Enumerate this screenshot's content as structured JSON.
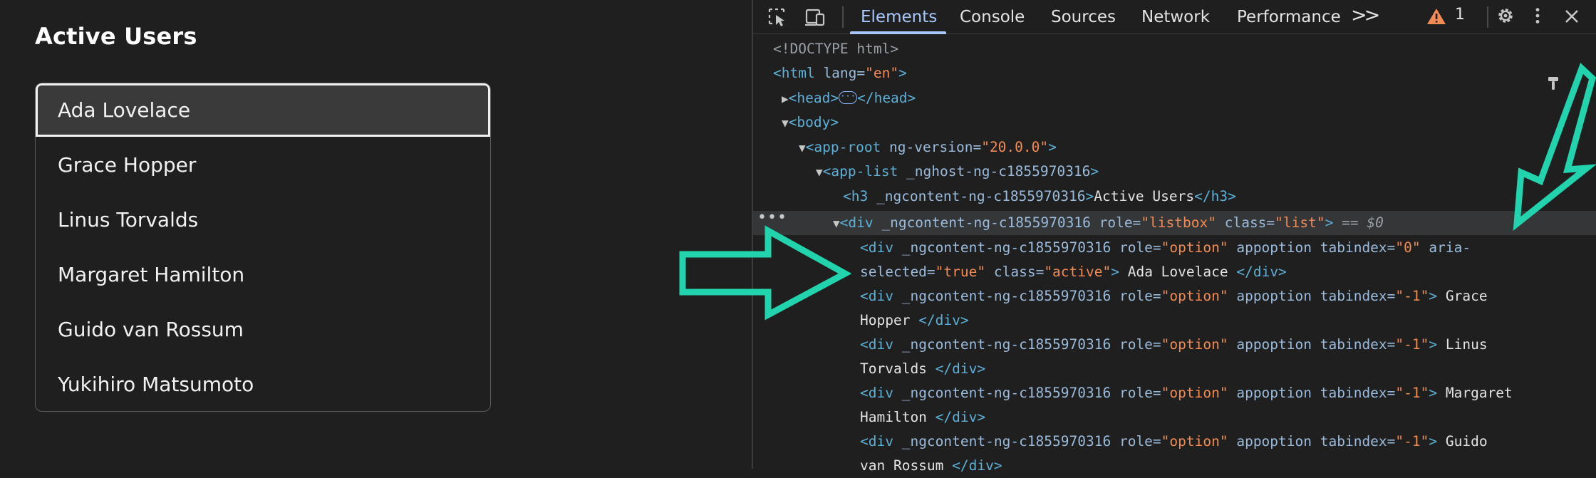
{
  "app": {
    "title": "Active Users",
    "options": [
      {
        "label": "Ada Lovelace",
        "active": true
      },
      {
        "label": "Grace Hopper",
        "active": false
      },
      {
        "label": "Linus Torvalds",
        "active": false
      },
      {
        "label": "Margaret Hamilton",
        "active": false
      },
      {
        "label": "Guido van Rossum",
        "active": false
      },
      {
        "label": "Yukihiro Matsumoto",
        "active": false
      }
    ]
  },
  "devtools": {
    "tabs": [
      "Elements",
      "Console",
      "Sources",
      "Network",
      "Performance"
    ],
    "selected_tab": "Elements",
    "more_tabs": ">>",
    "warning_count": "1",
    "colors": {
      "accent": "#a8c7fa",
      "arrow": "#21d4ae",
      "warning": "#f28b54"
    },
    "icons": [
      "inspect-element-icon",
      "device-toolbar-icon",
      "warning-icon",
      "settings-gear-icon",
      "kebab-menu-icon",
      "close-icon",
      "filter-icon"
    ],
    "code": {
      "doctype": "<!DOCTYPE html>",
      "html_open": "<html",
      "html_attr": " lang=",
      "html_val": "\"en\"",
      "html_close": ">",
      "head_open": "<head>",
      "head_close": "</head>",
      "body": "<body>",
      "approot_open": "<app-root",
      "approot_attr": " ng-version=",
      "approot_val": "\"20.0.0\"",
      "approot_close": ">",
      "applist_open": "<app-list",
      "applist_attr": " _nghost-ng-c1855970316",
      "applist_close": ">",
      "h3_open": "<h3",
      "h3_attr": " _ngcontent-ng-c1855970316",
      "h3_gt": ">",
      "h3_text": "Active Users",
      "h3_close": "</h3>",
      "div_open": "<div",
      "ngc_attr": " _ngcontent-ng-c1855970316",
      "role_attr": " role=",
      "listbox_val": "\"listbox\"",
      "class_attr": " class=",
      "list_val": "\"list\"",
      "gt": ">",
      "eq_marker": " == $0",
      "option_val": "\"option\"",
      "appoption_attr": " appoption",
      "tabindex_attr": " tabindex=",
      "tabindex0_val": "\"0\"",
      "tabindexm1_val": "\"-1\"",
      "aria_attr": " aria-",
      "selected_attr": "selected=",
      "true_val": "\"true\"",
      "active_val": "\"active\"",
      "div_close": "</div>",
      "opt1_text": " Ada Lovelace ",
      "opt2_text_a": " Grace",
      "opt2_text_b": "Hopper ",
      "opt3_text_a": " Linus",
      "opt3_text_b": "Torvalds ",
      "opt4_text_a": " Margaret",
      "opt4_text_b": "Hamilton ",
      "opt5_text_a": " Guido",
      "opt5_text_b": "van Rossum "
    }
  }
}
